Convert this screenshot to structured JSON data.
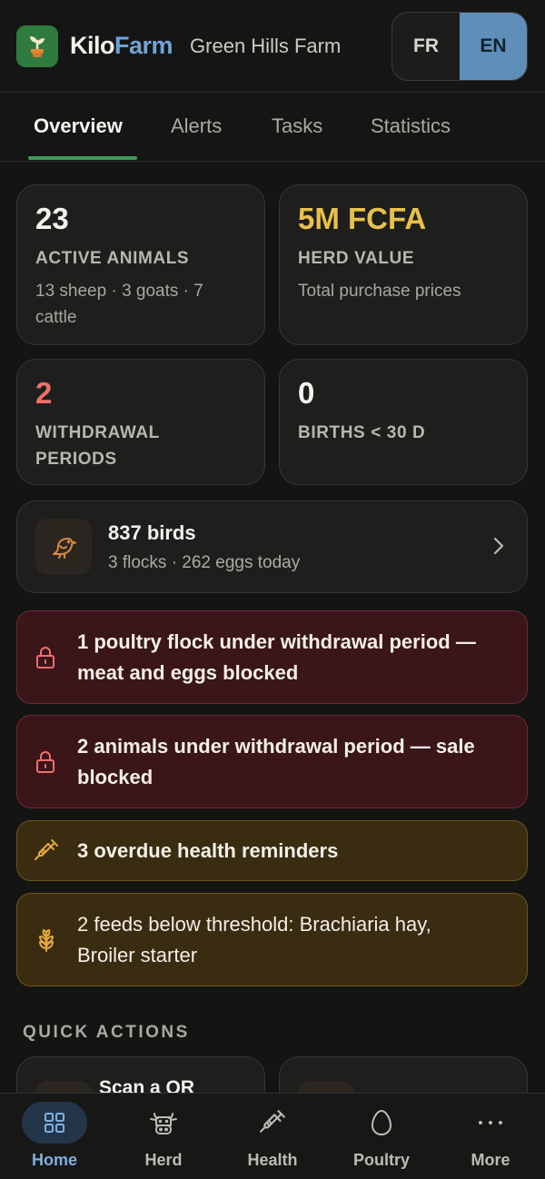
{
  "header": {
    "brand_kilo": "Kilo",
    "brand_farm": "Farm",
    "farm_name": "Green Hills Farm",
    "lang_fr": "FR",
    "lang_en": "EN",
    "active_lang": "EN"
  },
  "tabs": [
    {
      "label": "Overview",
      "active": true
    },
    {
      "label": "Alerts",
      "active": false
    },
    {
      "label": "Tasks",
      "active": false
    },
    {
      "label": "Statistics",
      "active": false
    }
  ],
  "stats": {
    "animals": {
      "value": "23",
      "label": "ACTIVE ANIMALS",
      "sub_line1": "13 sheep · 3 goats · 7",
      "sub_line2": "cattle"
    },
    "herd_value": {
      "value": "5M FCFA",
      "label": "HERD VALUE",
      "sub": "Total purchase prices",
      "color": "#e8c04a"
    },
    "withdrawal": {
      "value": "2",
      "label_line1": "WITHDRAWAL",
      "label_line2": "PERIODS",
      "color": "#ef6f6c"
    },
    "births": {
      "value": "0",
      "label": "BIRTHS < 30 D"
    }
  },
  "birds": {
    "title": "837 birds",
    "sub": "3 flocks · 262 eggs today",
    "icon": "bird-icon"
  },
  "alerts": [
    {
      "type": "red",
      "icon": "lock-icon",
      "line1": "1 poultry flock under withdrawal period —",
      "line2": "meat and eggs blocked"
    },
    {
      "type": "red",
      "icon": "lock-icon",
      "line1": "2 animals under withdrawal period — sale",
      "line2": "blocked"
    },
    {
      "type": "amber",
      "icon": "syringe-icon",
      "line1": "3 overdue health reminders"
    },
    {
      "type": "amber",
      "icon": "wheat-icon",
      "line1": "2 feeds below threshold: Brachiaria hay,",
      "line2": "Broiler starter"
    }
  ],
  "quick_actions": {
    "title": "QUICK ACTIONS",
    "items": [
      {
        "label": "Scan a QR"
      },
      {
        "label": ""
      }
    ]
  },
  "bottom_nav": [
    {
      "label": "Home",
      "icon": "grid-icon",
      "active": true
    },
    {
      "label": "Herd",
      "icon": "cow-icon",
      "active": false
    },
    {
      "label": "Health",
      "icon": "syringe-icon",
      "active": false
    },
    {
      "label": "Poultry",
      "icon": "egg-icon",
      "active": false
    },
    {
      "label": "More",
      "icon": "more-icon",
      "active": false
    }
  ],
  "colors": {
    "accent_green": "#3f9a58",
    "accent_blue": "#5f8fb8",
    "alert_red_bg": "#3a1519",
    "alert_amber_bg": "#3a2c10"
  }
}
